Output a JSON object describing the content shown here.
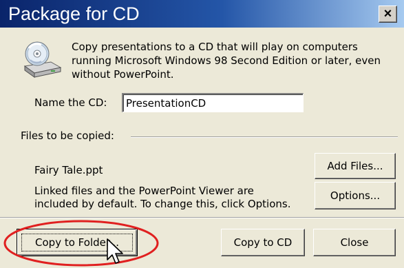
{
  "window": {
    "title": "Package for CD",
    "close_label": "×"
  },
  "icons": {
    "disc": "cd-drive-icon",
    "close": "close-icon",
    "cursor": "mouse-pointer-icon"
  },
  "intro": {
    "line1": "Copy presentations to a CD that will play on computers",
    "line2": "running Microsoft Windows 98 Second Edition or later, even",
    "line3": "without PowerPoint."
  },
  "cd_name": {
    "label": "Name the CD:",
    "value": "PresentationCD"
  },
  "files": {
    "group_label": "Files to be copied:",
    "file_name": "Fairy Tale.ppt",
    "add_files_label": "Add Files...",
    "linked_line1": "Linked files and the PowerPoint Viewer are",
    "linked_line2": "included by default. To change this, click Options.",
    "options_label": "Options..."
  },
  "actions": {
    "copy_to_folder_label": "Copy to Folder...",
    "copy_to_cd_label": "Copy to CD",
    "close_label": "Close"
  },
  "colors": {
    "title_bar_start": "#0a246a",
    "title_bar_end": "#a6caf0",
    "dialog_bg": "#ece9d8",
    "highlight_ellipse": "#e02020"
  }
}
